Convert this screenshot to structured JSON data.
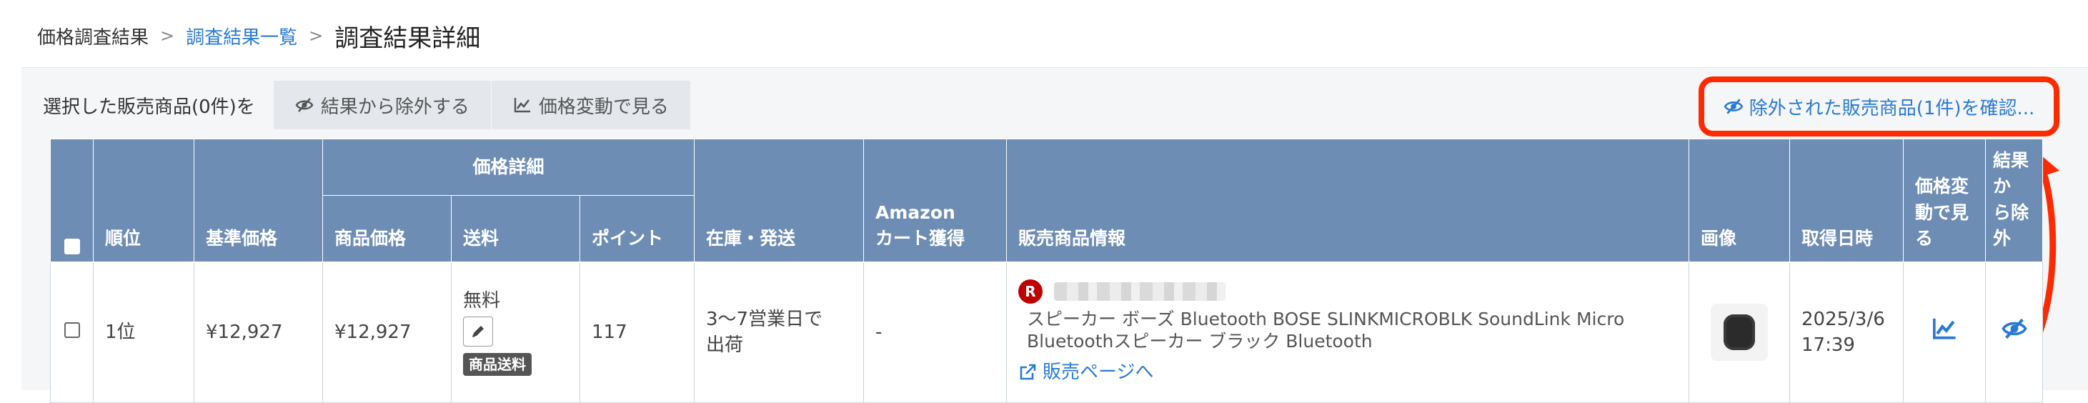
{
  "breadcrumb": {
    "root": "価格調査結果",
    "separator": ">",
    "parent": "調査結果一覧",
    "current": "調査結果詳細"
  },
  "action_bar": {
    "selected_label": "選択した販売商品(0件)を",
    "exclude_button": "結果から除外する",
    "price_change_button": "価格変動で見る",
    "excluded_link": "除外された販売商品(1件)を確認..."
  },
  "table": {
    "headers": {
      "rank": "順位",
      "base_price": "基準価格",
      "price_detail_group": "価格詳細",
      "item_price": "商品価格",
      "shipping": "送料",
      "points": "ポイント",
      "stock": "在庫・発送",
      "amazon_cart": "Amazon\nカート獲得",
      "product_info": "販売商品情報",
      "image": "画像",
      "acquired_at": "取得日時",
      "price_change": "価格変\n動で見\nる",
      "exclude": "結果か\nら除外"
    },
    "rows": [
      {
        "rank": "1位",
        "base_price": "¥12,927",
        "item_price": "¥12,927",
        "shipping": "無料",
        "shipping_badge": "商品送料",
        "points": "117",
        "stock": "3〜7営業日で\n出荷",
        "amazon_cart": "-",
        "seller_logo": "R",
        "product_name": "スピーカー ボーズ Bluetooth BOSE SLINKMICROBLK SoundLink Micro Bluetoothスピーカー ブラック Bluetooth",
        "sale_page_link": "販売ページへ",
        "acquired_at": "2025/3/6\n17:39"
      }
    ]
  },
  "colors": {
    "header_bg": "#6e8db4",
    "link": "#2a7ad2",
    "highlight_box": "#ff2a00",
    "rakuten_red": "#bf0000"
  },
  "icons": [
    "eye-slash-icon",
    "line-chart-icon",
    "pencil-icon",
    "external-link-icon",
    "arrow-up-icon"
  ]
}
